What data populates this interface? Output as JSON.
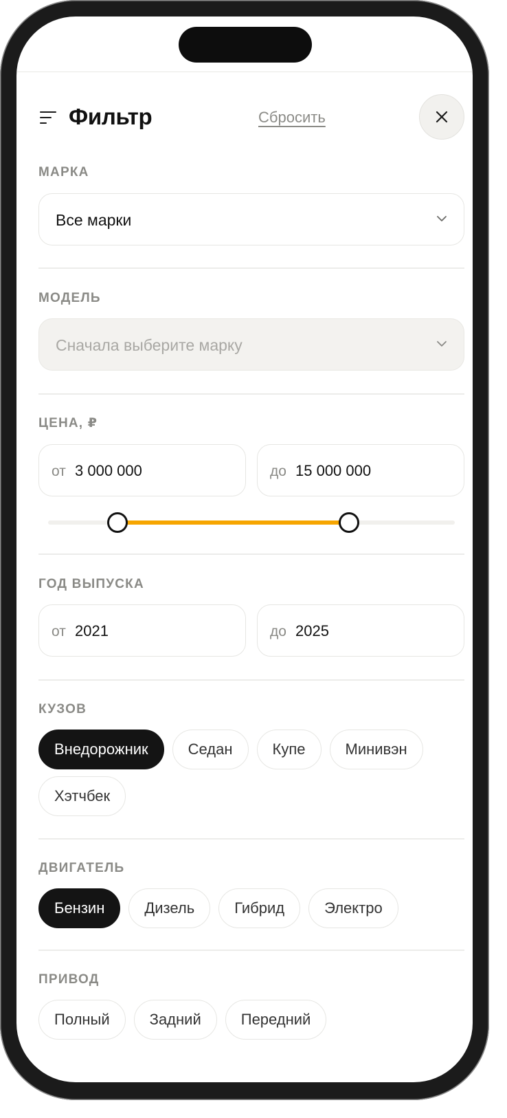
{
  "header": {
    "title": "Фильтр",
    "reset_label": "Сбросить"
  },
  "brand": {
    "label": "МАРКА",
    "value": "Все марки"
  },
  "model": {
    "label": "МОДЕЛЬ",
    "placeholder": "Сначала выберите марку"
  },
  "price": {
    "label": "ЦЕНА, ₽",
    "from_prefix": "от",
    "from_value": "3 000 000",
    "to_prefix": "до",
    "to_value": "15 000 000",
    "slider_low_fraction": 0.17,
    "slider_high_fraction": 0.74
  },
  "year": {
    "label": "ГОД ВЫПУСКА",
    "from_prefix": "от",
    "from_value": "2021",
    "to_prefix": "до",
    "to_value": "2025"
  },
  "body": {
    "label": "КУЗОВ",
    "options": [
      {
        "label": "Внедорожник",
        "selected": true
      },
      {
        "label": "Седан",
        "selected": false
      },
      {
        "label": "Купе",
        "selected": false
      },
      {
        "label": "Минивэн",
        "selected": false
      },
      {
        "label": "Хэтчбек",
        "selected": false
      }
    ]
  },
  "engine": {
    "label": "ДВИГАТЕЛЬ",
    "options": [
      {
        "label": "Бензин",
        "selected": true
      },
      {
        "label": "Дизель",
        "selected": false
      },
      {
        "label": "Гибрид",
        "selected": false
      },
      {
        "label": "Электро",
        "selected": false
      }
    ]
  },
  "drive": {
    "label": "ПРИВОД",
    "options": [
      {
        "label": "Полный",
        "selected": false
      },
      {
        "label": "Задний",
        "selected": false
      },
      {
        "label": "Передний",
        "selected": false
      }
    ]
  },
  "colors": {
    "accent": "#f6a500",
    "chip_active_bg": "#141414",
    "muted_text": "#8a8a86"
  },
  "icons": {
    "filter": "filter-lines-icon",
    "close": "close-icon",
    "dropdown": "chevron-down-icon"
  }
}
